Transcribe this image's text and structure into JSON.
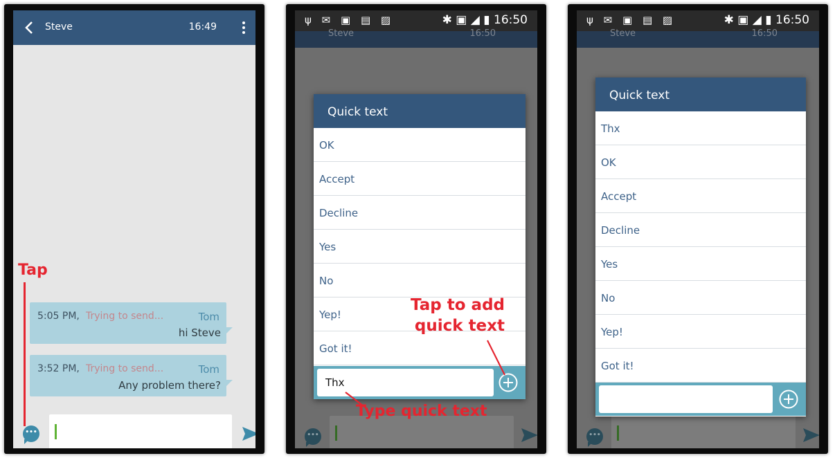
{
  "colors": {
    "appbar": "#34577c",
    "bubble": "#acd2de",
    "accent": "#3e8ba9",
    "annotation": "#e52530",
    "dialog_footer": "#61a9bd"
  },
  "screen1": {
    "title": "Steve",
    "time": "16:49",
    "back_icon": "chevron-left-icon",
    "menu_icon": "more-vertical-icon",
    "messages": [
      {
        "time": "5:05 PM,",
        "status": "Trying to send...",
        "sender": "Tom",
        "text": "hi Steve"
      },
      {
        "time": "3:52 PM,",
        "status": "Trying to send...",
        "sender": "Tom",
        "text": "Any problem there?"
      }
    ],
    "quick_text_icon": "chat-bubble-icon",
    "send_icon": "send-icon",
    "annotation": "Tap"
  },
  "screen2": {
    "status_time": "16:50",
    "bg_title": "Steve",
    "bg_time": "16:50",
    "dialog_title": "Quick text",
    "items": [
      "OK",
      "Accept",
      "Decline",
      "Yes",
      "No",
      "Yep!",
      "Got it!"
    ],
    "input_value": "Thx",
    "add_icon": "plus-circle-icon",
    "annotation_add_line1": "Tap to add",
    "annotation_add_line2": "quick text",
    "annotation_type": "Type quick text"
  },
  "screen3": {
    "status_time": "16:50",
    "bg_title": "Steve",
    "bg_time": "16:50",
    "dialog_title": "Quick text",
    "items": [
      "Thx",
      "OK",
      "Accept",
      "Decline",
      "Yes",
      "No",
      "Yep!",
      "Got it!"
    ],
    "input_value": "",
    "add_icon": "plus-circle-icon"
  }
}
